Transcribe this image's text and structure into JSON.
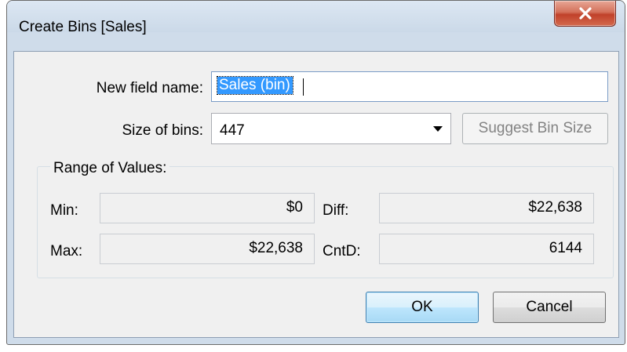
{
  "dialog": {
    "title": "Create Bins [Sales]"
  },
  "fields": {
    "new_field_name_label": "New field name:",
    "new_field_name_value": "Sales (bin)",
    "size_of_bins_label": "Size of bins:",
    "size_of_bins_value": "447",
    "suggest_button_label": "Suggest Bin Size"
  },
  "range": {
    "group_label": "Range of Values:",
    "min_label": "Min:",
    "min_value": "$0",
    "diff_label": "Diff:",
    "diff_value": "$22,638",
    "max_label": "Max:",
    "max_value": "$22,638",
    "cntd_label": "CntD:",
    "cntd_value": "6144"
  },
  "buttons": {
    "ok": "OK",
    "cancel": "Cancel"
  },
  "icons": {
    "close": "close-icon",
    "dropdown": "chevron-down-icon"
  },
  "colors": {
    "selection": "#3399ff",
    "close_button": "#c0412a",
    "default_button": "#3c7fb1"
  }
}
